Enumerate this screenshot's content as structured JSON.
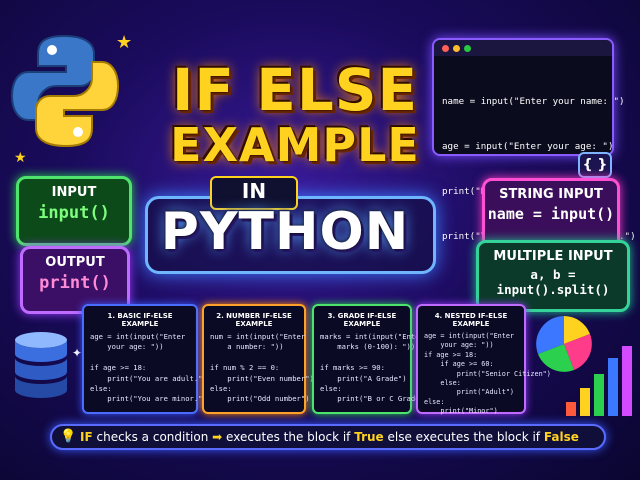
{
  "title": {
    "line1": "IF ELSE",
    "line2": "EXAMPLE",
    "line3": "IN",
    "line4": "PYTHON"
  },
  "left_panels": {
    "input": {
      "label": "INPUT",
      "code": "input()"
    },
    "output": {
      "label": "OUTPUT",
      "code": "print()"
    }
  },
  "right_panels": {
    "string_input": {
      "label": "STRING INPUT",
      "code": "name = input()"
    },
    "multiple_input": {
      "label": "MULTIPLE INPUT",
      "code": "a, b = input().split()"
    }
  },
  "code_window": {
    "lines": [
      "name = input(\"Enter your name: \")",
      "age = input(\"Enter your age: \")",
      "print(\"Hello,\", name + \"!\")",
      "print(\"You are\", age, \"years old.\")"
    ],
    "braces": "{ }"
  },
  "examples": [
    {
      "title": "1. BASIC IF-ELSE EXAMPLE",
      "code": "age = int(input(\"Enter\n    your age: \"))\n\nif age >= 18:\n    print(\"You are adult.\")\nelse:\n    print(\"You are minor.\")"
    },
    {
      "title": "2. NUMBER IF-ELSE EXAMPLE",
      "code": "num = int(input(\"Enter\n    a number: \"))\n\nif num % 2 == 0:\n    print(\"Even number\")\nelse:\n    print(\"Odd number\")"
    },
    {
      "title": "3. GRADE IF-ELSE EXAMPLE",
      "code": "marks = int(input(\"Enter\n    marks (0-100): \"))\n\nif marks >= 90:\n    print(\"A Grade\")\nelse:\n    print(\"B or C Grade\")"
    },
    {
      "title": "4. NESTED IF-ELSE EXAMPLE",
      "code": "age = int(input(\"Enter\n    your age: \"))\nif age >= 18:\n    if age >= 60:\n        print(\"Senior Citizen\")\n    else:\n        print(\"Adult\")\nelse:\n    print(\"Minor\")"
    }
  ],
  "banner": {
    "part1": "IF",
    "part2": " checks a condition ",
    "arrow": "➡",
    "part3": " executes the block if ",
    "part4": "True",
    "part5": "  else executes the block if ",
    "part6": "False",
    "icon": "lightbulb-icon"
  },
  "colors": {
    "title_yellow": "#ffd21f",
    "python_blue": "#3b77c9",
    "python_yellow": "#ffd43b",
    "input_green": "#4ee36c",
    "output_purple": "#c06bff",
    "string_pink": "#ff4fd2"
  }
}
